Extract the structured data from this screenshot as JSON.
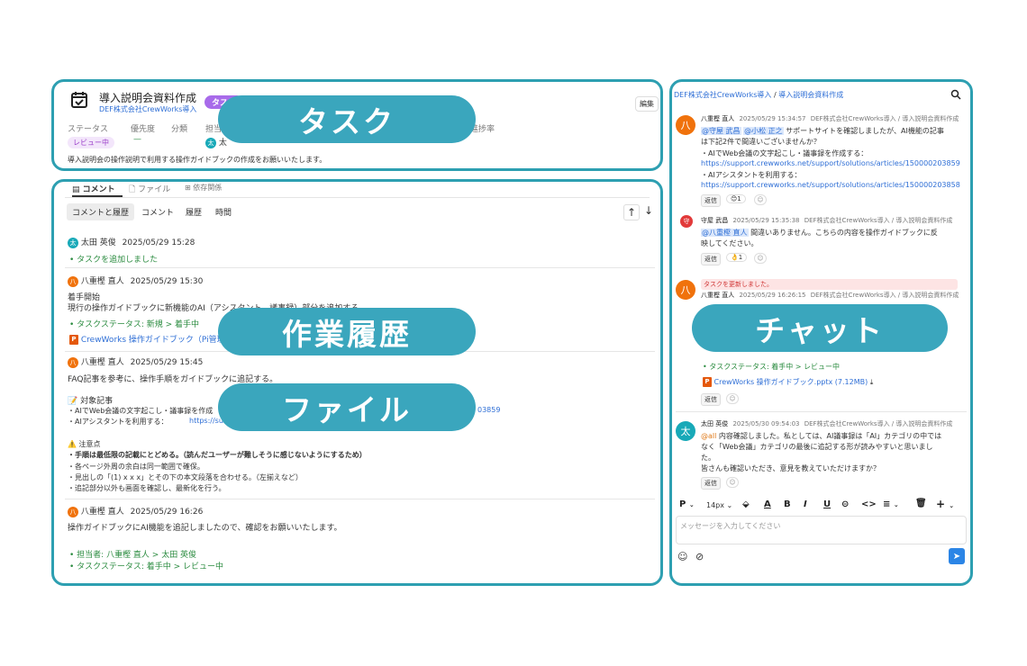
{
  "task": {
    "title": "導入説明会資料作成",
    "project": "DEF株式会社CrewWorks導入",
    "label_badge": "タスク",
    "edit_label": "編集",
    "fields": {
      "status_label": "ステータス",
      "priority_label": "優先度",
      "category_label": "分類",
      "assignee_label": "担当者",
      "progress_label": "進捗率"
    },
    "status_value": "レビュー中",
    "priority_value": "—",
    "assignee_initial": "太",
    "assignee_name": "太",
    "description": "導入説明会の操作説明で利用する操作ガイドブックの作成をお願いいたします。"
  },
  "history": {
    "tabs": [
      {
        "label": "コメント",
        "icon": "comment-icon"
      },
      {
        "label": "ファイル",
        "icon": "file-icon"
      },
      {
        "label": "依存関係",
        "icon": "dependency-icon"
      }
    ],
    "filters": [
      "コメントと履歴",
      "コメント",
      "履歴",
      "時間"
    ],
    "sort_up": "↑",
    "sort_down": "↓",
    "entries": [
      {
        "initial": "太",
        "author": "太田 英俊",
        "time": "2025/05/29 15:28",
        "changes": [
          "タスクを追加しました"
        ]
      },
      {
        "initial": "八",
        "author": "八重樫 直人",
        "time": "2025/05/29 15:30",
        "body": [
          "着手開始",
          "現行の操作ガイドブックに新機能のAI（アシスタント、議事録）部分を追加する。"
        ],
        "changes": [
          "タスクステータス: 新規 > 着手中"
        ],
        "file": "CrewWorks 操作ガイドブック（Pi管理追"
      },
      {
        "initial": "八",
        "author": "八重樫 直人",
        "time": "2025/05/29 15:45",
        "body": [
          "FAQ記事を参考に、操作手順をガイドブックに追記する。",
          "📝 対象記事",
          "・AIでWeb会議の文字起こし・議事録を作成",
          "03859",
          "・AIアシスタントを利用する：",
          "https://su",
          "⚠️ 注意点",
          "・手順は最低限の記載にとどめる。（読んだユーザーが難しそうに感じないようにするため）",
          "・各ページ外周の余白は同一範囲で確保。",
          "・見出しの「(1) x x x」とその下の本文段落を合わせる。（左揃えなど）",
          "・追記部分以外も画面を確認し、最新化を行う。"
        ]
      },
      {
        "initial": "八",
        "author": "八重樫 直人",
        "time": "2025/05/29 16:26",
        "body": [
          "操作ガイドブックにAI機能を追記しましたので、確認をお願いいたします。"
        ],
        "changes": [
          "担当者: 八重樫 直人 > 太田 英俊",
          "タスクステータス: 着手中 > レビュー中"
        ]
      }
    ]
  },
  "chat": {
    "breadcrumb_project": "DEF株式会社CrewWorks導入",
    "breadcrumb_sep": "/",
    "breadcrumb_task": "導入説明会資料作成",
    "reply_label": "返信",
    "messages": [
      {
        "initial": "八",
        "author": "八重樫 直人",
        "time": "2025/05/29 15:34:57",
        "context": "DEF株式会社CrewWorks導入 / 導入説明会資料作成",
        "mentions": [
          "@守屋 武昌",
          "@小松 正之"
        ],
        "text_1": "サポートサイトを確認しましたが、AI機能の記事",
        "text_2": "は下記2件で間違いございませんか？",
        "text_3": "・AIでWeb会議の文字起こし・議事録を作成する：",
        "url_1": "https://support.crewworks.net/support/solutions/articles/150000203859",
        "text_4": "・AIアシスタントを利用する：",
        "url_2": "https://support.crewworks.net/support/solutions/articles/150000203858",
        "reaction": "😊1"
      },
      {
        "initial": "守",
        "author": "守屋 武昌",
        "time": "2025/05/29 15:35:38",
        "context": "DEF株式会社CrewWorks導入 / 導入説明会資料作成",
        "mention": "@八重樫 直人",
        "text_1": "間違いありません。こちらの内容を操作ガイドブックに反",
        "text_2": "映してください。",
        "reaction": "👌1"
      },
      {
        "initial": "八",
        "notice": "タスクを更新しました。",
        "author": "八重樫 直人",
        "time": "2025/05/29 16:26:15",
        "context": "DEF株式会社CrewWorks導入 / 導入説明会資料作成",
        "change": "タスクステータス: 着手中 > レビュー中",
        "file": "CrewWorks 操作ガイドブック.pptx (7.12MB)"
      },
      {
        "initial": "太",
        "author": "太田 英俊",
        "time": "2025/05/30 09:54:03",
        "context": "DEF株式会社CrewWorks導入 / 導入説明会資料作成",
        "mention": "@all",
        "text_1": "内容確認しました。私としては、AI議事録は「AI」カテゴリの中では",
        "text_2": "なく「Web会議」カテゴリの最後に追記する形が読みやすいと思いまし",
        "text_3": "た。",
        "text_4": "皆さんも確認いただき、意見を教えていただけますか？"
      }
    ],
    "toolbar": {
      "paragraph": "P",
      "font_size": "14px",
      "chev": "⌄"
    },
    "input_placeholder": "メッセージを入力してください"
  },
  "overlays": {
    "task": "タスク",
    "history": "作業履歴",
    "file": "ファイル",
    "chat": "チャット"
  },
  "colors": {
    "panel_border": "#2d9fb1",
    "overlay_pill": "#3aa6bd",
    "link": "#2f6fd6",
    "change_green": "#2a8b3f",
    "badge_purple": "#a86bea"
  }
}
